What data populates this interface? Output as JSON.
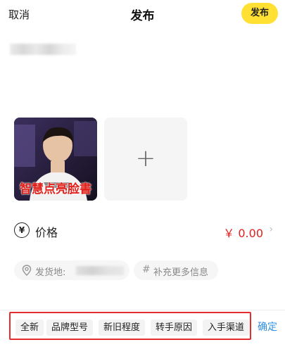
{
  "header": {
    "cancel_label": "取消",
    "title": "发布",
    "publish_label": "发布"
  },
  "images": {
    "photo_caption": "智慧点亮脸書",
    "add_symbol": "+"
  },
  "price": {
    "icon_symbol": "¥",
    "label": "价格",
    "value": "￥ 0.00",
    "chevron": "›"
  },
  "location": {
    "label": "发货地:",
    "more_symbol": "#",
    "more_label": "补充更多信息"
  },
  "tags": {
    "items": [
      "全新",
      "品牌型号",
      "新旧程度",
      "转手原因",
      "入手渠道"
    ],
    "confirm_label": "确定"
  },
  "colors": {
    "accent_yellow": "#ffe033",
    "price_red": "#e02020",
    "confirm_blue": "#2f8fe3",
    "highlight_border": "#e62c2c"
  },
  "icons": [
    "yen-circle-icon",
    "location-pin-icon",
    "hash-icon",
    "chevron-right-icon",
    "plus-icon"
  ]
}
